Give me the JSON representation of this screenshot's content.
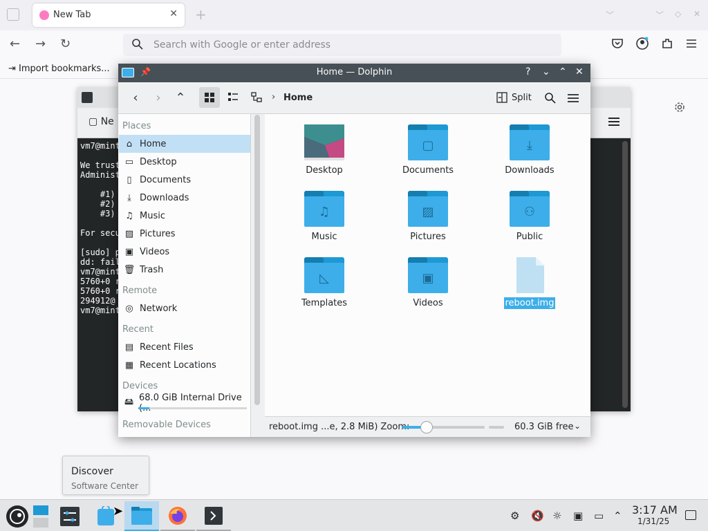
{
  "browser": {
    "tab_title": "New Tab",
    "url_placeholder": "Search with Google or enter address",
    "import_bookmarks": "Import bookmarks..."
  },
  "terminal": {
    "new_tab_label": "Ne",
    "lines": [
      "vm7@mint",
      "",
      "We trust",
      "Administ",
      "",
      "    #1)",
      "    #2)",
      "    #3)",
      "",
      "For secu",
      "",
      "[sudo] p",
      "dd: fail",
      "vm7@mint",
      "5760+0 r",
      "5760+0 r",
      "294912@",
      "vm7@mint"
    ]
  },
  "dolphin": {
    "title": "Home — Dolphin",
    "breadcrumb": "Home",
    "split_label": "Split",
    "sidebar": {
      "places_header": "Places",
      "places": [
        {
          "label": "Home",
          "icon": "home-icon",
          "selected": true
        },
        {
          "label": "Desktop",
          "icon": "desktop-icon"
        },
        {
          "label": "Documents",
          "icon": "documents-icon"
        },
        {
          "label": "Downloads",
          "icon": "downloads-icon"
        },
        {
          "label": "Music",
          "icon": "music-icon"
        },
        {
          "label": "Pictures",
          "icon": "pictures-icon"
        },
        {
          "label": "Videos",
          "icon": "videos-icon"
        },
        {
          "label": "Trash",
          "icon": "trash-icon"
        }
      ],
      "remote_header": "Remote",
      "remote": [
        {
          "label": "Network",
          "icon": "network-icon"
        }
      ],
      "recent_header": "Recent",
      "recent": [
        {
          "label": "Recent Files",
          "icon": "recent-files-icon"
        },
        {
          "label": "Recent Locations",
          "icon": "recent-locations-icon"
        }
      ],
      "devices_header": "Devices",
      "devices": [
        {
          "label": "68.0 GiB Internal Drive (...",
          "icon": "drive-icon",
          "usage": 0.1
        }
      ],
      "removable_header": "Removable Devices"
    },
    "files": [
      {
        "name": "Desktop",
        "type": "desktop-folder"
      },
      {
        "name": "Documents",
        "type": "folder",
        "glyph": "documents-icon"
      },
      {
        "name": "Downloads",
        "type": "folder",
        "glyph": "downloads-icon"
      },
      {
        "name": "Music",
        "type": "folder",
        "glyph": "music-icon"
      },
      {
        "name": "Pictures",
        "type": "folder",
        "glyph": "pictures-icon"
      },
      {
        "name": "Public",
        "type": "folder",
        "glyph": "public-icon"
      },
      {
        "name": "Templates",
        "type": "folder",
        "glyph": "templates-icon"
      },
      {
        "name": "Videos",
        "type": "folder",
        "glyph": "videos-icon"
      },
      {
        "name": "reboot.img",
        "type": "file",
        "selected": true
      }
    ],
    "status": {
      "selection_text": "reboot.img ...e, 2.8 MiB) Zoom:",
      "zoom_level": 0.3,
      "free_space": "60.3 GiB free"
    }
  },
  "tooltip": {
    "title": "Discover",
    "subtitle": "Software Center"
  },
  "taskbar": {
    "time": "3:17 AM",
    "date": "1/31/25"
  },
  "colors": {
    "accent": "#3daee9",
    "titlebar": "#475057",
    "selection_bg": "#c2e0f5"
  }
}
